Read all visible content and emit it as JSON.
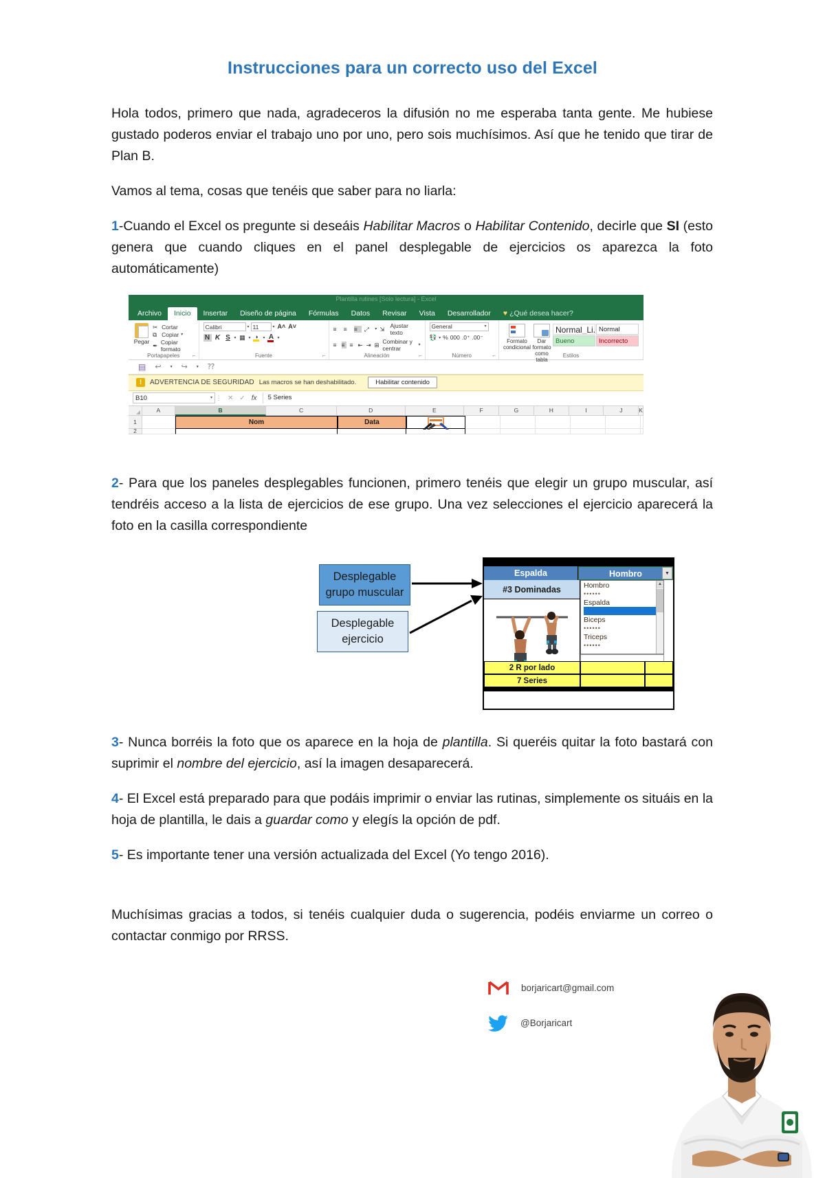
{
  "document": {
    "title": "Instrucciones para un correcto uso del Excel",
    "title_color": "#2E75B6",
    "paragraphs": {
      "intro": "Hola todos, primero que nada, agradeceros la difusión no me esperaba tanta gente.  Me hubiese gustado poderos enviar el trabajo uno por uno, pero sois muchísimos. Así que he tenido que tirar de Plan B.",
      "lead": "Vamos al tema, cosas que tenéis que saber para no liarla:",
      "item1": {
        "number": "1",
        "part_a": "-Cuando el Excel os pregunte si deseáis ",
        "em_a": "Habilitar Macros",
        "part_b": " o ",
        "em_b": "Habilitar Contenido",
        "part_c": ", decirle que ",
        "strong": "SI",
        "part_d": " (esto genera que cuando cliques en el panel desplegable de ejercicios os aparezca la foto automáticamente)"
      },
      "item2": {
        "number": "2",
        "text": "- Para que los paneles desplegables funcionen, primero tenéis que elegir un grupo muscular, así tendréis acceso a la lista de ejercicios de ese grupo. Una vez selecciones el ejercicio aparecerá la foto en la casilla correspondiente"
      },
      "item3": {
        "number": "3",
        "part_a": "- Nunca borréis la foto que os aparece en la hoja de ",
        "em_a": "plantilla",
        "part_b": ". Si queréis quitar la foto bastará con suprimir el ",
        "em_b": "nombre del ejercicio",
        "part_c": ", así la imagen desaparecerá."
      },
      "item4": {
        "number": "4",
        "part_a": "- El Excel está preparado para que podáis imprimir o enviar las rutinas, simplemente os situáis en la hoja de plantilla, le dais a ",
        "em_a": "guardar como",
        "part_b": " y elegís la opción de pdf."
      },
      "item5": {
        "number": "5",
        "text": "- Es importante tener una versión actualizada del Excel (Yo tengo 2016)."
      },
      "closing": "Muchísimas gracias a todos, si tenéis cualquier duda o sugerencia, podéis enviarme un correo o contactar conmigo por RRSS."
    }
  },
  "excel_figure": {
    "title_bar": "Plantilla rutines  [Solo lectura] - Excel",
    "ribbon_tabs": [
      "Archivo",
      "Inicio",
      "Insertar",
      "Diseño de página",
      "Fórmulas",
      "Datos",
      "Revisar",
      "Vista",
      "Desarrollador"
    ],
    "active_tab": "Inicio",
    "tell_me": "¿Qué desea hacer?",
    "clipboard": {
      "group_label": "Portapapeles",
      "paste": "Pegar",
      "cut": "Cortar",
      "copy": "Copiar",
      "format_painter": "Copiar formato"
    },
    "font": {
      "group_label": "Fuente",
      "family": "Calibri",
      "size": "11",
      "grow": "A",
      "shrink": "A",
      "bold": "N",
      "italic": "K",
      "underline": "S",
      "fill_letter": "A"
    },
    "alignment": {
      "group_label": "Alineación",
      "wrap_text": "Ajustar texto",
      "merge_center": "Combinar y centrar"
    },
    "number": {
      "group_label": "Número",
      "format": "General",
      "currency": "%",
      "thousands": "000"
    },
    "styles": {
      "group_label": "Estilos",
      "conditional": "Formato condicional",
      "as_table": "Dar formato como tabla",
      "cell_styles": [
        "Normal_Li...",
        "Normal",
        "Bueno",
        "Incorrecto"
      ]
    },
    "quick_access": [
      "save-icon",
      "undo-icon",
      "redo-icon",
      "help-icon"
    ],
    "security_bar": {
      "label": "ADVERTENCIA DE SEGURIDAD",
      "message": "Las macros se han deshabilitado.",
      "button": "Habilitar contenido"
    },
    "formula_bar": {
      "name_box": "B10",
      "value": "5 Series",
      "cancel": "✕",
      "accept": "✓",
      "fx": "fx"
    },
    "grid": {
      "columns": [
        "A",
        "B",
        "C",
        "D",
        "E",
        "F",
        "G",
        "H",
        "I",
        "J",
        "K"
      ],
      "selected_column": "B",
      "rows": [
        "1",
        "2"
      ],
      "cells": {
        "b1": "Nom",
        "d1": "Data"
      }
    }
  },
  "dropdown_figure": {
    "callouts": [
      {
        "line1": "Desplegable",
        "line2": "grupo muscular"
      },
      {
        "line1": "Desplegable",
        "line2": "ejercicio"
      }
    ],
    "sheet": {
      "header_left": "Espalda",
      "header_right": "Hombro",
      "exercise": "#3 Dominadas",
      "dropdown_items": [
        "Hombro",
        "Espalda",
        "Biceps",
        "Triceps"
      ],
      "dropdown_selected": "Espalda",
      "dots": "••••••",
      "yellow_rows": [
        "2 R por lado",
        "7 Series"
      ]
    }
  },
  "footer": {
    "email": "borjaricart@gmail.com",
    "twitter": "@Borjaricart",
    "email_icon": "gmail-icon",
    "twitter_icon": "twitter-icon",
    "gmail_red": "#D93025",
    "twitter_blue": "#1DA1F2"
  }
}
